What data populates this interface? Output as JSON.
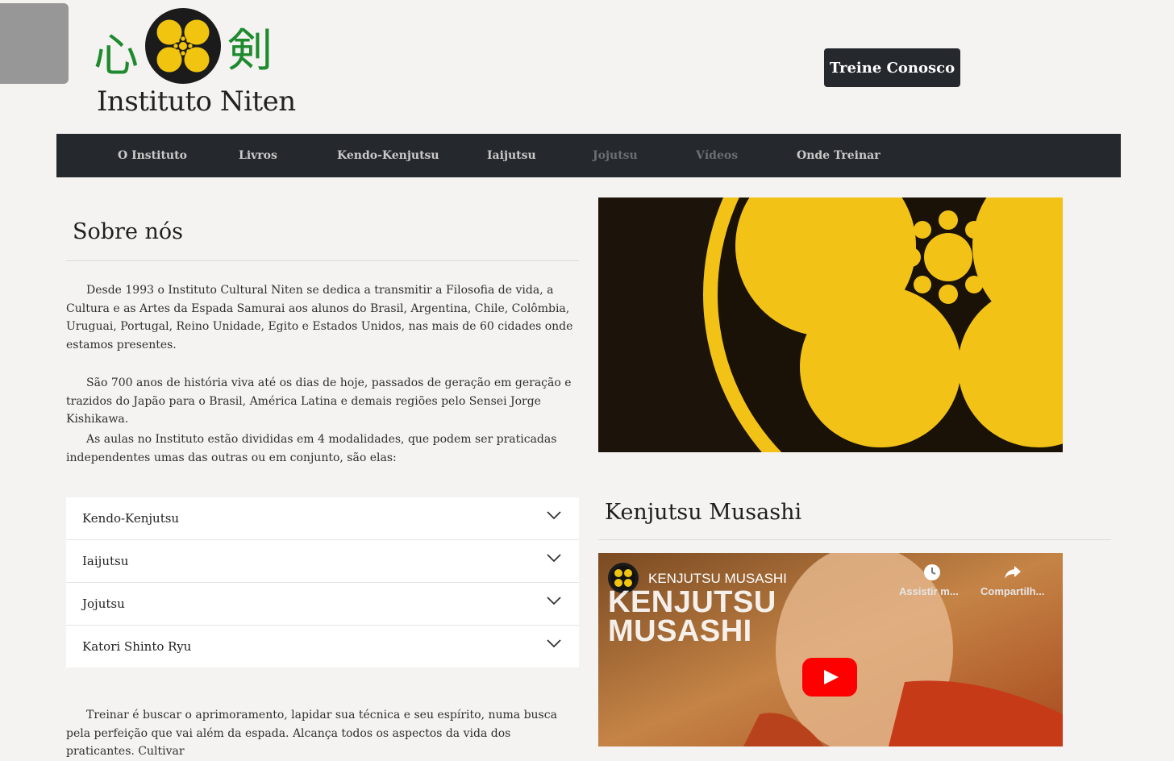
{
  "colors": {
    "page_bg": "#f4f3f1",
    "nav_bg": "#25282c",
    "accent_green": "#1e8a2e",
    "mon_yellow": "#f1c40f",
    "play_red": "#ff0000"
  },
  "header": {
    "logo": {
      "kanji_left": "心",
      "kanji_right": "剣",
      "text": "Instituto Niten",
      "icon": "niten-mon-icon"
    },
    "cta_label": "Treine Conosco"
  },
  "nav": {
    "items": [
      {
        "label": "O Instituto",
        "dim": false
      },
      {
        "label": "Livros",
        "dim": false
      },
      {
        "label": "Kendo-Kenjutsu",
        "dim": false
      },
      {
        "label": "Iaijutsu",
        "dim": false
      },
      {
        "label": "Jojutsu",
        "dim": true
      },
      {
        "label": "Vídeos",
        "dim": true
      },
      {
        "label": "Onde Treinar",
        "dim": false
      }
    ]
  },
  "about": {
    "title": "Sobre nós",
    "paragraphs": [
      "Desde 1993 o Instituto Cultural Niten se dedica a transmitir a Filosofia de vida, a Cultura e as Artes da Espada Samurai aos alunos do Brasil, Argentina, Chile, Colômbia, Uruguai, Portugal, Reino Unidade, Egito e Estados Unidos, nas mais de 60 cidades onde estamos presentes.",
      "São 700 anos de história viva até os dias de hoje, passados de geração em geração e trazidos do Japão para o Brasil, América Latina e demais regiões pelo Sensei Jorge Kishikawa.",
      "As aulas no Instituto estão divididas em 4 modalidades, que podem ser praticadas independentes umas das outras ou em conjunto, são elas:"
    ],
    "accordion": [
      "Kendo-Kenjutsu",
      "Iaijutsu",
      "Jojutsu",
      "Katori Shinto Ryu"
    ],
    "closing": "Treinar é buscar o aprimoramento, lapidar sua técnica e seu espírito, numa busca pela perfeição que vai além da espada. Alcança todos os aspectos da vida dos praticantes. Cultivar"
  },
  "video_section": {
    "title": "Kenjutsu Musashi",
    "video_title": "KENJUTSU MUSASHI",
    "overlay_text_1": "KENJUTSU",
    "overlay_text_2": "MUSASHI",
    "watch_later": "Assistir m...",
    "share": "Compartilh...",
    "icons": [
      "clock-icon",
      "share-icon",
      "play-icon"
    ]
  }
}
